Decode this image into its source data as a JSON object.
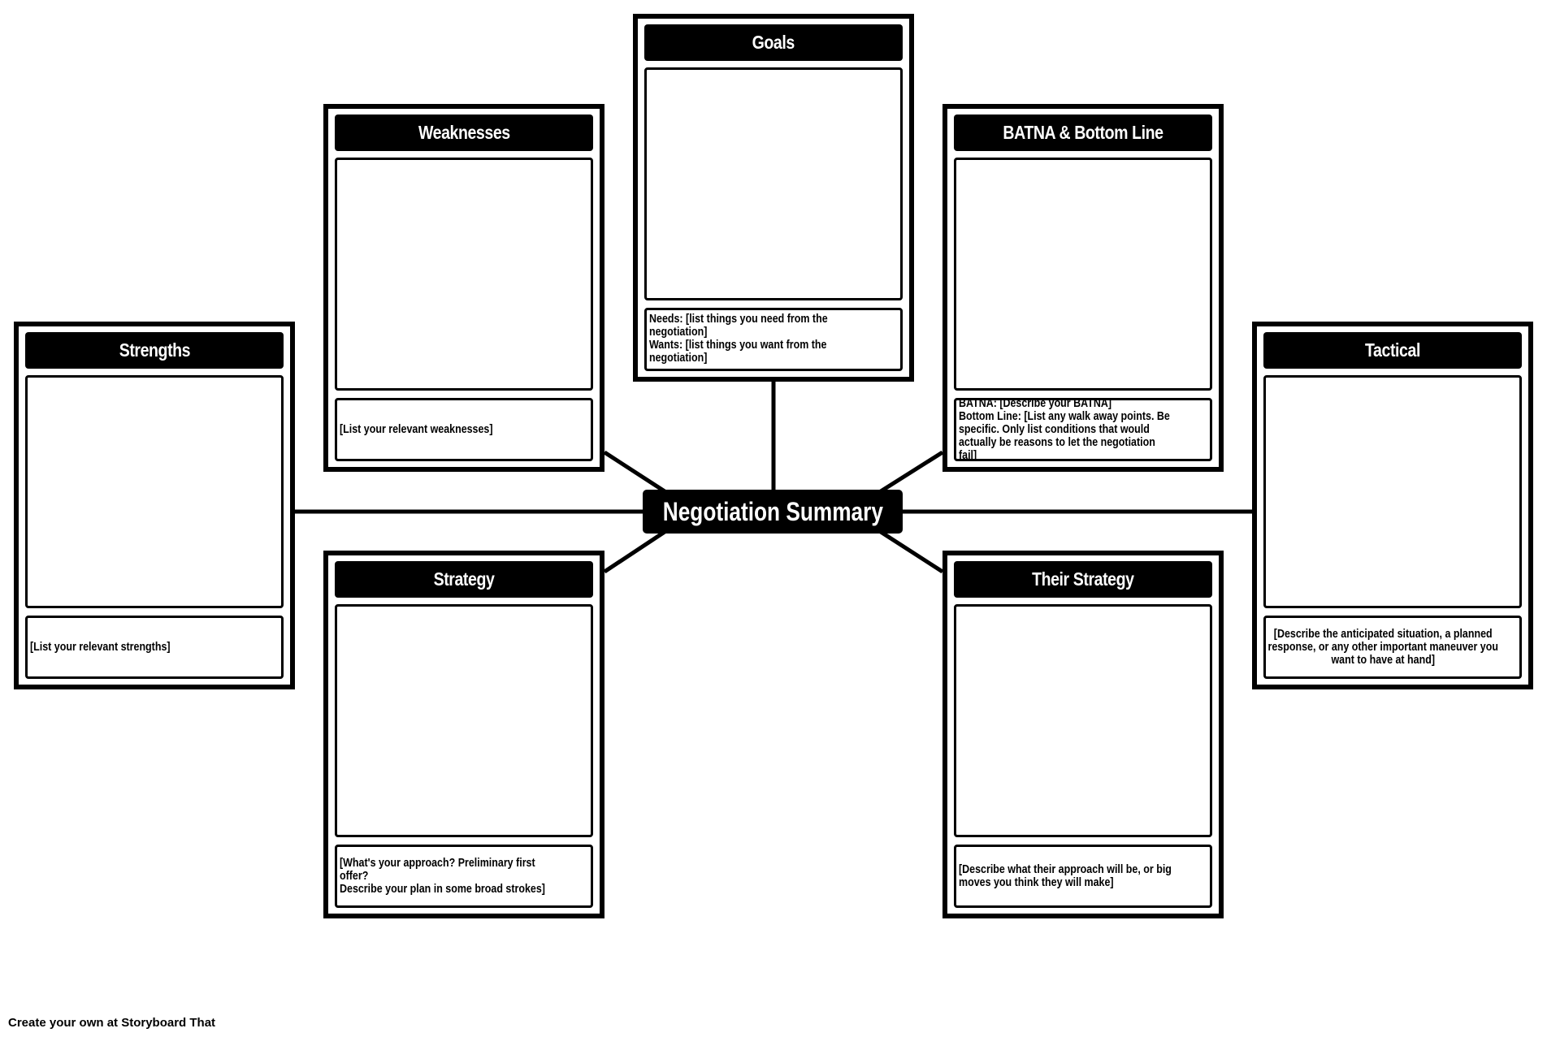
{
  "diagram": {
    "center_title": "Negotiation Summary",
    "panels": {
      "goals": {
        "title": "Goals",
        "note": "Needs: [list things you need from the\nnegotiation]\nWants: [list things you want from the\nnegotiation]"
      },
      "weaknesses": {
        "title": "Weaknesses",
        "note": "[List your relevant weaknesses]"
      },
      "batna": {
        "title": "BATNA & Bottom Line",
        "note": "BATNA: [Describe your BATNA]\nBottom Line: [List any walk away points. Be\nspecific. Only list conditions that would\nactually be reasons to let the negotiation fail]"
      },
      "strengths": {
        "title": "Strengths",
        "note": "[List your relevant strengths]"
      },
      "tactical": {
        "title": "Tactical",
        "note": "[Describe the anticipated situation, a planned response, or any other important maneuver you want to have at hand]"
      },
      "strategy": {
        "title": "Strategy",
        "note": "[What's your approach? Preliminary first offer?\nDescribe your plan in some broad strokes]"
      },
      "their_strategy": {
        "title": "Their Strategy",
        "note": "[Describe what their approach will be, or big\nmoves you think they will make]"
      }
    }
  },
  "footer": {
    "credit": "Create your own at Storyboard That"
  },
  "colors": {
    "ink": "#000000",
    "paper": "#ffffff"
  }
}
